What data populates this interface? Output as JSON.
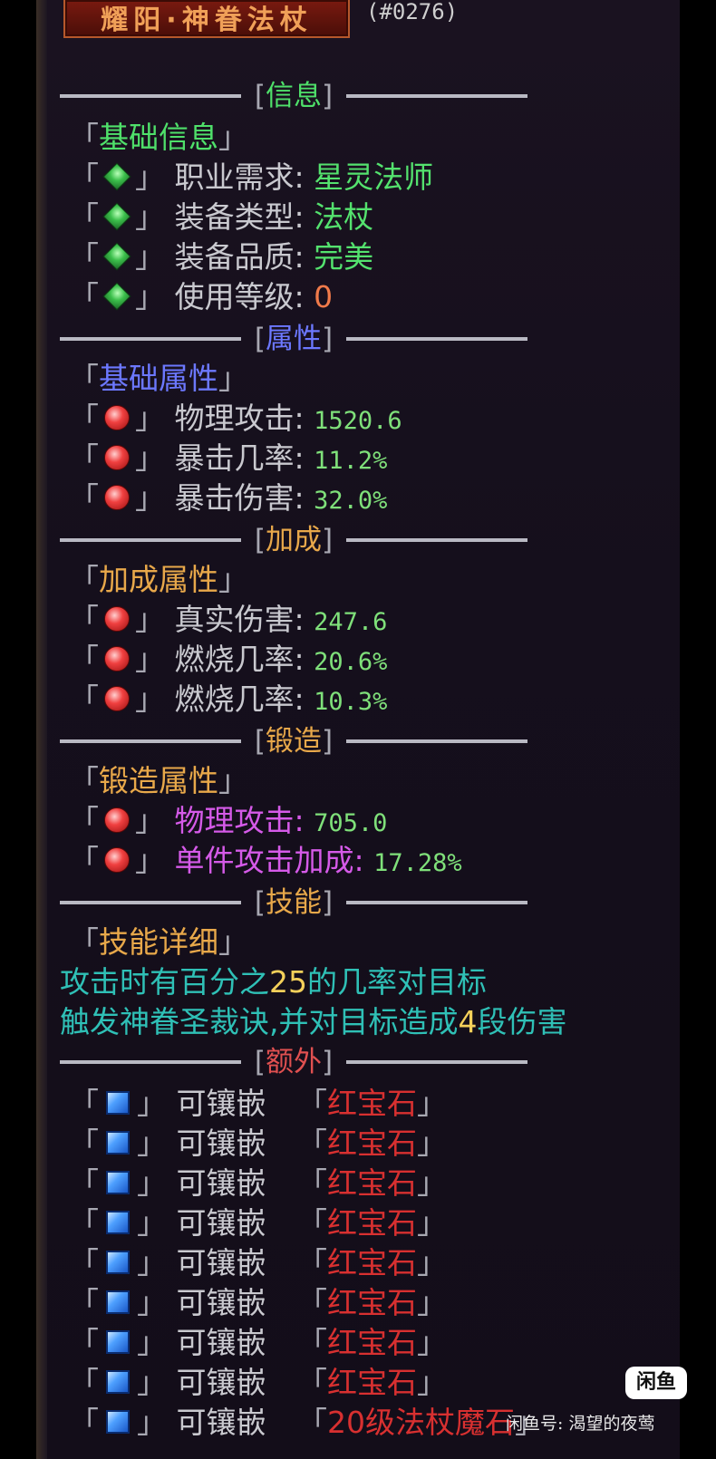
{
  "header": {
    "title": "耀阳·神眷法杖",
    "code": "(#0276)"
  },
  "sections": {
    "info": {
      "label": "信息"
    },
    "attr": {
      "label": "属性"
    },
    "bonus": {
      "label": "加成"
    },
    "forge": {
      "label": "锻造"
    },
    "skill": {
      "label": "技能"
    },
    "extra": {
      "label": "额外"
    }
  },
  "bracket_open": "「",
  "bracket_close": "」",
  "info": {
    "heading": "基础信息",
    "rows": [
      {
        "label": "职业需求:",
        "value": "星灵法师"
      },
      {
        "label": "装备类型:",
        "value": "法杖"
      },
      {
        "label": "装备品质:",
        "value": "完美"
      },
      {
        "label": "使用等级:",
        "value": "0"
      }
    ]
  },
  "attr": {
    "heading": "基础属性",
    "rows": [
      {
        "label": "物理攻击:",
        "value": "1520.6"
      },
      {
        "label": "暴击几率:",
        "value": "11.2%"
      },
      {
        "label": "暴击伤害:",
        "value": "32.0%"
      }
    ]
  },
  "bonus": {
    "heading": "加成属性",
    "rows": [
      {
        "label": "真实伤害:",
        "value": "247.6"
      },
      {
        "label": "燃烧几率:",
        "value": "20.6%"
      },
      {
        "label": "燃烧几率:",
        "value": "10.3%"
      }
    ]
  },
  "forge": {
    "heading": "锻造属性",
    "rows": [
      {
        "label": "物理攻击:",
        "value": "705.0"
      },
      {
        "label": "单件攻击加成:",
        "value": "17.28%"
      }
    ]
  },
  "skill": {
    "heading": "技能详细",
    "line1_a": "攻击时有百分之",
    "line1_num": "25",
    "line1_b": "的几率对目标",
    "line2_a": "触发神眷圣裁诀,并对目标造成",
    "line2_num": "4",
    "line2_b": "段伤害"
  },
  "extra": {
    "socket_label": "可镶嵌",
    "gem_name": "红宝石",
    "socket_count": 8,
    "partial_gem": "20级法杖魔石"
  },
  "watermark": {
    "badge": "闲鱼",
    "text": "闲鱼号: 渴望的夜莺"
  },
  "colors": {
    "info_header": "#4fe06a",
    "attr_header": "#6c78ff",
    "bonus_header": "#e8a84a",
    "forge_label": "#d55ae8",
    "skill_text": "#2fc0b6",
    "gem_red": "#d83030"
  },
  "icons": {
    "info": "green-gem-icon",
    "attr": "red-gem-icon",
    "socket": "blue-socket-icon"
  }
}
